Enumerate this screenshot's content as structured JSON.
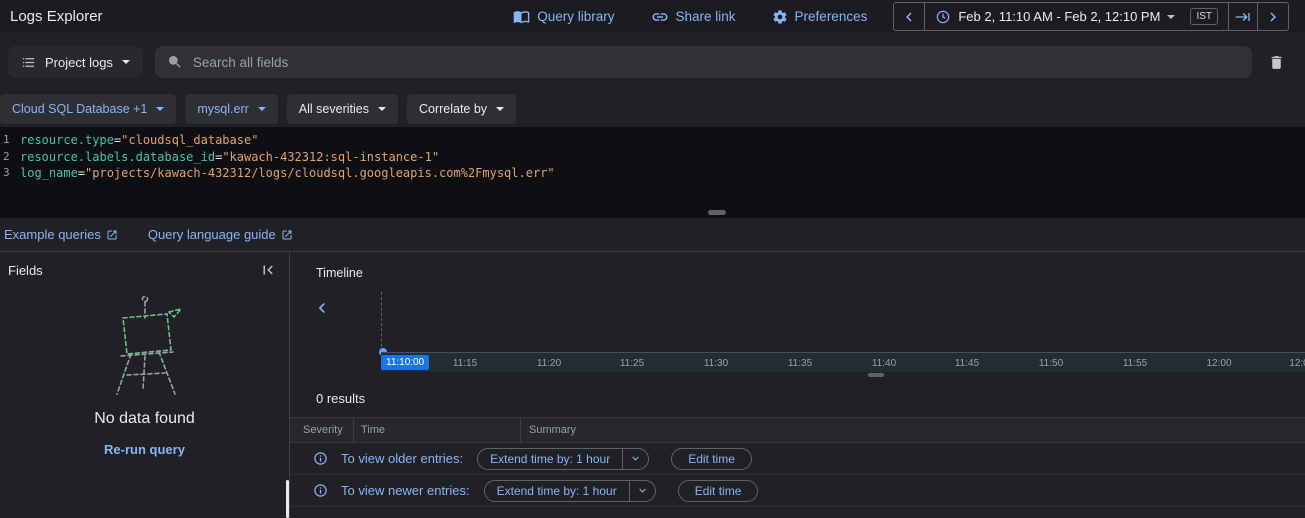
{
  "header": {
    "title": "Logs Explorer",
    "actions": [
      {
        "label": "Query library",
        "icon": "book-icon"
      },
      {
        "label": "Share link",
        "icon": "link-icon"
      },
      {
        "label": "Preferences",
        "icon": "gear-icon"
      }
    ],
    "time_control": {
      "range_label": "Feb 2, 11:10 AM - Feb 2, 12:10 PM",
      "timezone": "IST"
    }
  },
  "search_bar": {
    "scope_button": "Project logs",
    "placeholder": "Search all fields"
  },
  "filter_chips": [
    {
      "label": "Cloud SQL Database +1"
    },
    {
      "label": "mysql.err"
    },
    {
      "label": "All severities"
    },
    {
      "label": "Correlate by"
    }
  ],
  "query_editor": {
    "lines": [
      {
        "number": "1",
        "key": "resource.type",
        "operator": "=",
        "value": "\"cloudsql_database\""
      },
      {
        "number": "2",
        "key": "resource.labels.database_id",
        "operator": "=",
        "value": "\"kawach-432312:sql-instance-1\""
      },
      {
        "number": "3",
        "key": "log_name",
        "operator": "=",
        "value": "\"projects/kawach-432312/logs/cloudsql.googleapis.com%2Fmysql.err\""
      }
    ]
  },
  "links": {
    "example_queries": "Example queries",
    "query_language_guide": "Query language guide"
  },
  "fields_panel": {
    "title": "Fields",
    "empty_state": {
      "title": "No data found",
      "action": "Re-run query"
    }
  },
  "timeline": {
    "title": "Timeline",
    "selected_time": "11:10:00",
    "ticks": [
      "11:15",
      "11:20",
      "11:25",
      "11:30",
      "11:35",
      "11:40",
      "11:45",
      "11:50",
      "11:55",
      "12:00",
      "12:0"
    ]
  },
  "results": {
    "count": "0 results",
    "columns": [
      "Severity",
      "Time",
      "Summary"
    ],
    "notices": [
      {
        "text": "To view older entries:",
        "extend_button": "Extend time by: 1 hour",
        "edit_button": "Edit time"
      },
      {
        "text": "To view newer entries:",
        "extend_button": "Extend time by: 1 hour",
        "edit_button": "Edit time"
      }
    ]
  },
  "icons": {
    "query_library": "book-icon",
    "share_link": "link-icon",
    "preferences": "gear-icon",
    "time": "clock-icon",
    "scope": "list-icon",
    "search": "search-icon",
    "clear": "trash-icon",
    "external_link": "external-link-icon",
    "collapse": "collapse-left-icon",
    "info": "info-icon"
  },
  "colors": {
    "accent_blue": "#8ab4f8",
    "selected_tick_bg": "#1a73e8",
    "code_key": "#45c5ab",
    "code_value": "#e0a16e",
    "background": "#202124",
    "editor_background": "#0d0f12"
  }
}
